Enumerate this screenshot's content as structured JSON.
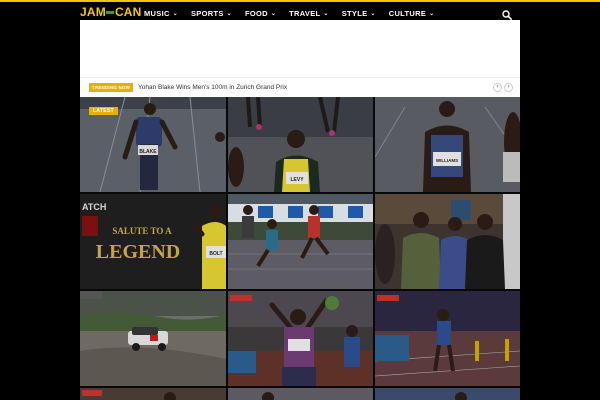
{
  "header": {
    "logo_text": "JAM",
    "logo_text_end": "CAN",
    "nav": [
      {
        "label": "MUSIC"
      },
      {
        "label": "SPORTS"
      },
      {
        "label": "FOOD"
      },
      {
        "label": "TRAVEL"
      },
      {
        "label": "STYLE"
      },
      {
        "label": "CULTURE"
      }
    ],
    "chevron": "⌄"
  },
  "trending": {
    "badge": "TRENDING NOW",
    "headline": "Yohan Blake Wins Men's 100m in Zurich Grand Prix",
    "prev": "‹",
    "next": "›"
  },
  "grid": {
    "latest_label": "LATEST",
    "tile2_banner": "ATCH",
    "tile2_title": "SALUTE TO A",
    "tile2_legend": "LEGEND",
    "bib_blake": "BLAKE",
    "bib_levy": "LEVY",
    "bib_williams": "WILLIAMS",
    "bib_bolt": "BOLT"
  },
  "colors": {
    "accent": "#f7c600",
    "badge": "#e8b100",
    "green": "#2ea043"
  }
}
